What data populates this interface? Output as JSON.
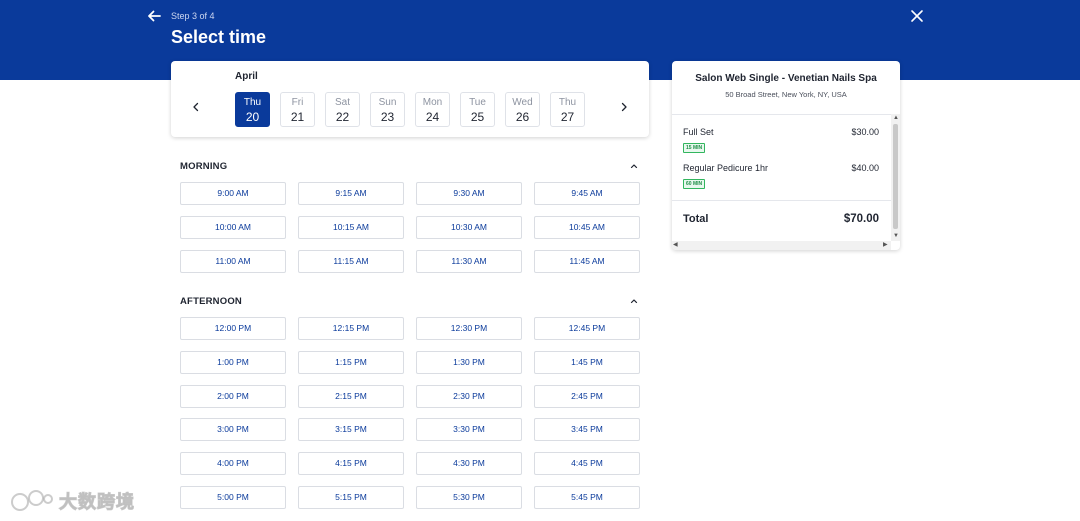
{
  "header": {
    "step": "Step 3 of 4",
    "title": "Select time",
    "back_icon": "arrow-left-icon",
    "close_icon": "close-icon"
  },
  "calendar": {
    "month": "April",
    "days": [
      {
        "dow": "Thu",
        "num": "20",
        "selected": true
      },
      {
        "dow": "Fri",
        "num": "21",
        "selected": false
      },
      {
        "dow": "Sat",
        "num": "22",
        "selected": false
      },
      {
        "dow": "Sun",
        "num": "23",
        "selected": false
      },
      {
        "dow": "Mon",
        "num": "24",
        "selected": false
      },
      {
        "dow": "Tue",
        "num": "25",
        "selected": false
      },
      {
        "dow": "Wed",
        "num": "26",
        "selected": false
      },
      {
        "dow": "Thu",
        "num": "27",
        "selected": false
      }
    ]
  },
  "morning": {
    "title": "MORNING",
    "slots": [
      "9:00 AM",
      "9:15 AM",
      "9:30 AM",
      "9:45 AM",
      "10:00 AM",
      "10:15 AM",
      "10:30 AM",
      "10:45 AM",
      "11:00 AM",
      "11:15 AM",
      "11:30 AM",
      "11:45 AM"
    ]
  },
  "afternoon": {
    "title": "AFTERNOON",
    "slots": [
      "12:00 PM",
      "12:15 PM",
      "12:30 PM",
      "12:45 PM",
      "1:00 PM",
      "1:15 PM",
      "1:30 PM",
      "1:45 PM",
      "2:00 PM",
      "2:15 PM",
      "2:30 PM",
      "2:45 PM",
      "3:00 PM",
      "3:15 PM",
      "3:30 PM",
      "3:45 PM",
      "4:00 PM",
      "4:15 PM",
      "4:30 PM",
      "4:45 PM",
      "5:00 PM",
      "5:15 PM",
      "5:30 PM",
      "5:45 PM"
    ]
  },
  "summary": {
    "salon_name": "Salon Web Single - Venetian Nails Spa",
    "address": "50 Broad Street, New York, NY, USA",
    "services": [
      {
        "name": "Full Set",
        "duration": "15 MIN",
        "price": "$30.00"
      },
      {
        "name": "Regular Pedicure 1hr",
        "duration": "60 MIN",
        "price": "$40.00"
      }
    ],
    "total_label": "Total",
    "total_value": "$70.00"
  },
  "watermark": {
    "text": "大数跨境"
  },
  "colors": {
    "brand": "#0a3a9b",
    "badge_green": "#32b65e"
  }
}
